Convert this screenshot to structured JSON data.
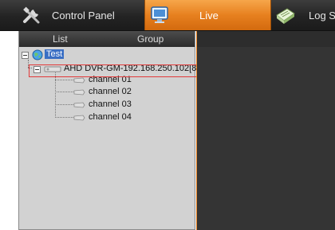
{
  "toolbar": {
    "control_panel_label": "Control Panel",
    "live_label": "Live",
    "log_label": "Log S",
    "accent_color": "#e7801f"
  },
  "left_panel": {
    "tabs": {
      "list": "List",
      "group": "Group"
    },
    "tree": {
      "root": "Test",
      "device": "AHD DVR-GM-192.168.250.102[80",
      "channels": [
        "channel 01",
        "channel 02",
        "channel 03",
        "channel 04"
      ]
    }
  },
  "icons": {
    "control_panel": "tools-icon",
    "live": "monitor-icon",
    "log": "log-document-icon",
    "root": "globe-icon",
    "device": "dvr-device-icon",
    "channel": "camera-icon"
  }
}
